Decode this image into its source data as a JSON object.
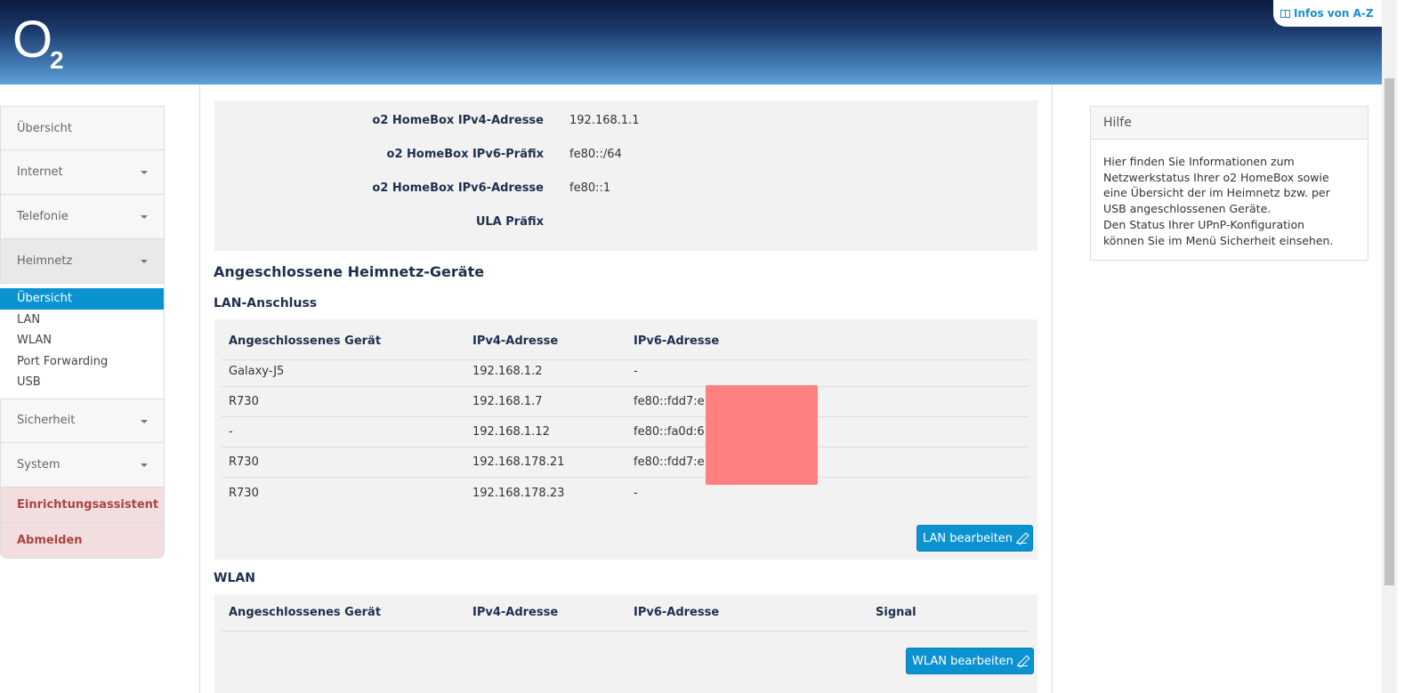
{
  "header": {
    "logo_o": "O",
    "logo_2": "2",
    "infos_label": "Infos von A-Z",
    "infos_icon": "book-icon"
  },
  "sidebar": {
    "items": [
      {
        "label": "Übersicht"
      },
      {
        "label": "Internet"
      },
      {
        "label": "Telefonie"
      },
      {
        "label": "Heimnetz"
      }
    ],
    "sub_items": [
      {
        "label": "Übersicht"
      },
      {
        "label": "LAN"
      },
      {
        "label": "WLAN"
      },
      {
        "label": "Port Forwarding"
      },
      {
        "label": "USB"
      }
    ],
    "items_after": [
      {
        "label": "Sicherheit"
      },
      {
        "label": "System"
      }
    ],
    "setup_label": "Einrichtungsassistent",
    "logout_label": "Abmelden"
  },
  "info": {
    "rows": [
      {
        "label": "o2 HomeBox IPv4-Adresse",
        "value": "192.168.1.1"
      },
      {
        "label": "o2 HomeBox IPv6-Präfix",
        "value": "fe80::/64"
      },
      {
        "label": "o2 HomeBox IPv6-Adresse",
        "value": "fe80::1"
      },
      {
        "label": "ULA Präfix",
        "value": ""
      }
    ]
  },
  "devices_heading": "Angeschlossene Heimnetz-Geräte",
  "lan": {
    "heading": "LAN-Anschluss",
    "columns": [
      "Angeschlossenes Gerät",
      "IPv4-Adresse",
      "IPv6-Adresse"
    ],
    "rows": [
      {
        "device": "Galaxy-J5",
        "ipv4": "192.168.1.2",
        "ipv6": "-"
      },
      {
        "device": "R730",
        "ipv4": "192.168.1.7",
        "ipv6": "fe80::fdd7:e"
      },
      {
        "device": "-",
        "ipv4": "192.168.1.12",
        "ipv6": "fe80::fa0d:6"
      },
      {
        "device": "R730",
        "ipv4": "192.168.178.21",
        "ipv6": "fe80::fdd7:e"
      },
      {
        "device": "R730",
        "ipv4": "192.168.178.23",
        "ipv6": "-"
      }
    ],
    "edit_label": "LAN bearbeiten"
  },
  "wlan": {
    "heading": "WLAN",
    "columns": [
      "Angeschlossenes Gerät",
      "IPv4-Adresse",
      "IPv6-Adresse",
      "Signal"
    ],
    "edit_label": "WLAN bearbeiten"
  },
  "help": {
    "title": "Hilfe",
    "lines": [
      "Hier finden Sie Informationen zum",
      "Netzwerkstatus Ihrer o2 HomeBox sowie",
      "eine Übersicht der im Heimnetz bzw. per",
      "USB angeschlossenen Geräte.",
      "Den Status Ihrer UPnP-Konfiguration",
      "können Sie im Menü Sicherheit einsehen."
    ]
  },
  "colors": {
    "accent": "#0b92d0",
    "danger_bg": "#f2dede",
    "danger_text": "#a94442",
    "redaction": "#ff8080"
  }
}
